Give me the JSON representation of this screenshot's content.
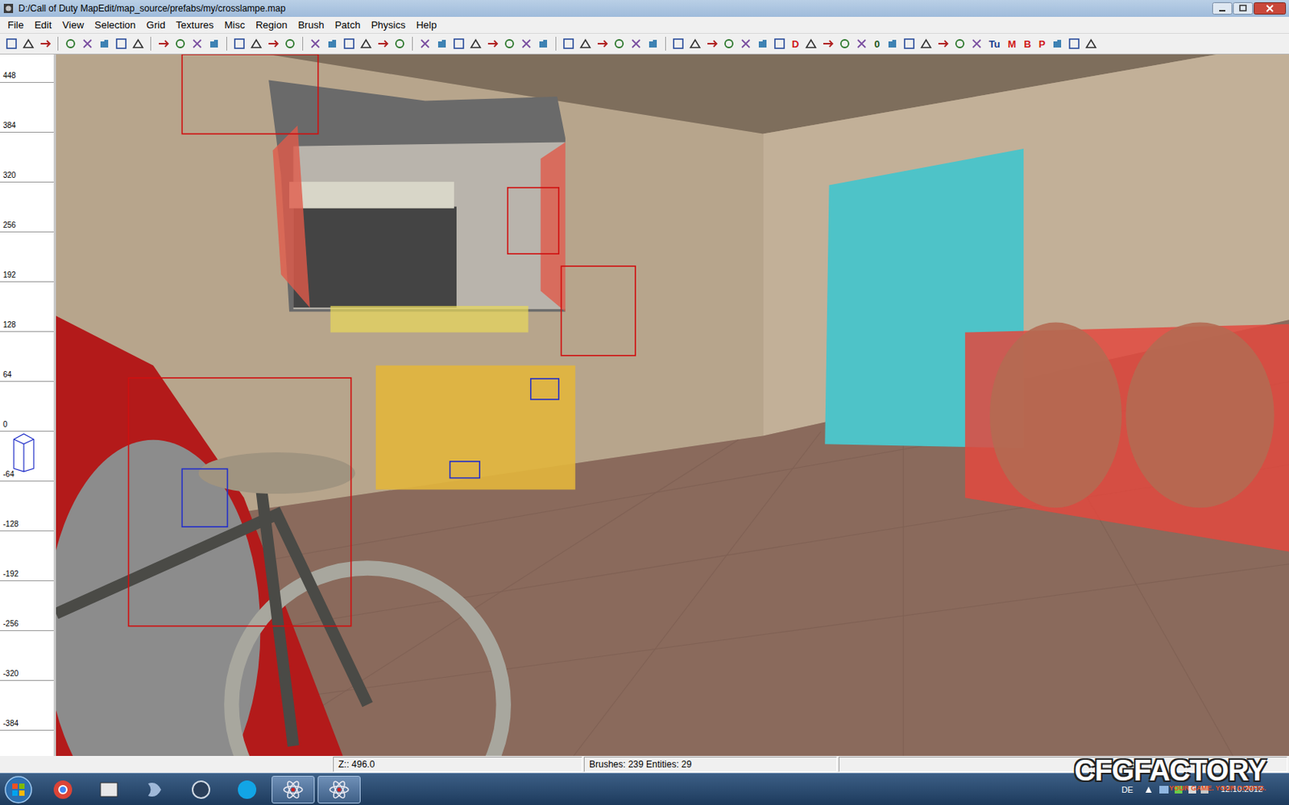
{
  "window": {
    "title": "D:/Call of Duty MapEdit/map_source/prefabs/my/crosslampe.map"
  },
  "menu": [
    "File",
    "Edit",
    "View",
    "Selection",
    "Grid",
    "Textures",
    "Misc",
    "Region",
    "Brush",
    "Patch",
    "Physics",
    "Help"
  ],
  "toolbar_text_buttons": [
    {
      "label": "D",
      "color": "#d01818"
    },
    {
      "label": "0",
      "color": "#1e5a1e"
    },
    {
      "label": "Tu",
      "color": "#1a3f8f"
    },
    {
      "label": "M",
      "color": "#d01818"
    },
    {
      "label": "B",
      "color": "#d01818"
    },
    {
      "label": "P",
      "color": "#d01818"
    }
  ],
  "ruler": {
    "ticks": [
      "448",
      "384",
      "320",
      "256",
      "192",
      "128",
      "64",
      "0",
      "-64",
      "-128",
      "-192",
      "-256",
      "-320",
      "-384"
    ]
  },
  "status_bar": [
    "Z:: 496.0",
    "Brushes: 239 Entities: 29"
  ],
  "watermark": {
    "brand": "CFGFACTORY",
    "slogan": "YOUR GAME. YOUR CONFIG."
  },
  "taskbar": {
    "apps": [
      {
        "name": "chrome",
        "selected": false
      },
      {
        "name": "radiant",
        "selected": false
      },
      {
        "name": "media",
        "selected": false
      },
      {
        "name": "steam",
        "selected": false
      },
      {
        "name": "skype",
        "selected": false
      },
      {
        "name": "mapedit-1",
        "selected": true
      },
      {
        "name": "mapedit-2",
        "selected": true
      }
    ],
    "language": "DE",
    "date": "12.10.2012"
  }
}
